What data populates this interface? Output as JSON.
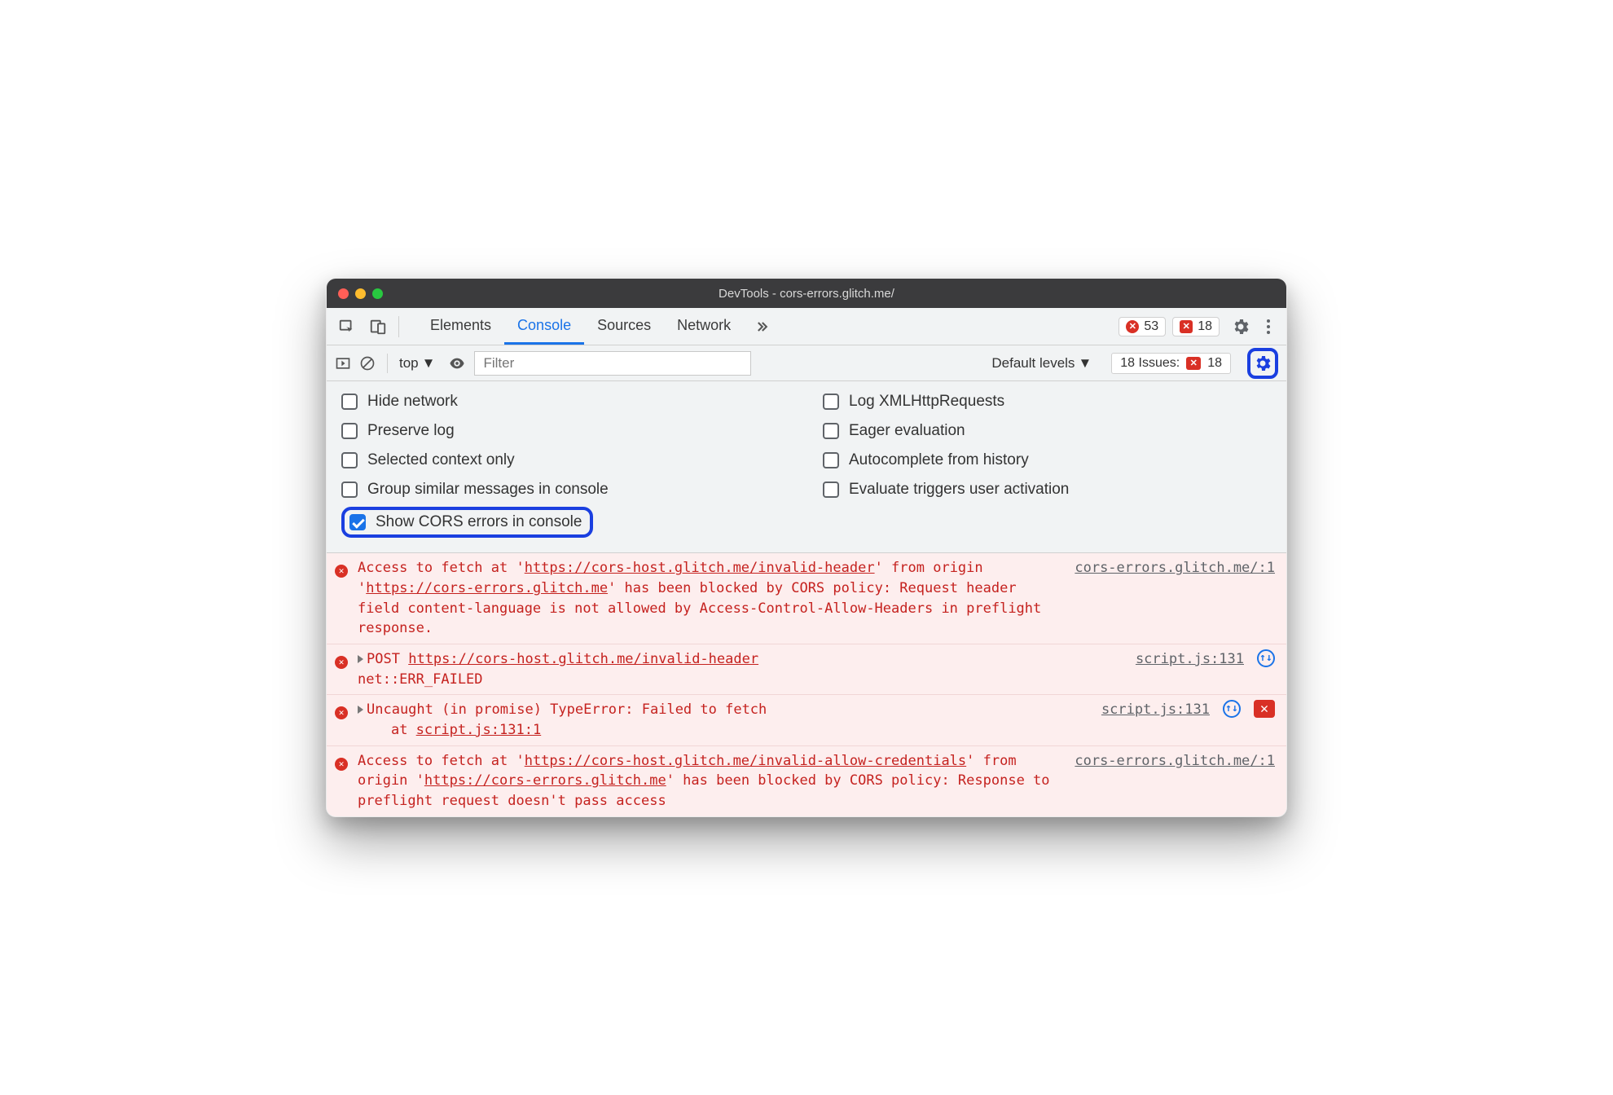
{
  "window": {
    "title": "DevTools - cors-errors.glitch.me/"
  },
  "tabs": {
    "items": [
      "Elements",
      "Console",
      "Sources",
      "Network"
    ],
    "active_index": 1
  },
  "tabbar_badges": {
    "errors": "53",
    "issues": "18"
  },
  "toolbar": {
    "context": "top",
    "filter_placeholder": "Filter",
    "levels_label": "Default levels",
    "issues_label": "18 Issues:",
    "issues_count": "18"
  },
  "settings": {
    "left": [
      {
        "label": "Hide network",
        "checked": false
      },
      {
        "label": "Preserve log",
        "checked": false
      },
      {
        "label": "Selected context only",
        "checked": false
      },
      {
        "label": "Group similar messages in console",
        "checked": false
      },
      {
        "label": "Show CORS errors in console",
        "checked": true,
        "highlight": true
      }
    ],
    "right": [
      {
        "label": "Log XMLHttpRequests",
        "checked": false
      },
      {
        "label": "Eager evaluation",
        "checked": false
      },
      {
        "label": "Autocomplete from history",
        "checked": false
      },
      {
        "label": "Evaluate triggers user activation",
        "checked": false
      }
    ]
  },
  "log_entries": [
    {
      "type": "cors",
      "pre": "Access to fetch at '",
      "url1": "https://cors-host.glitch.me/invalid-header",
      "mid": "' from origin '",
      "url2": "https://cors-errors.glitch.me",
      "post": "' has been blocked by CORS policy: Request header field content-language is not allowed by Access-Control-Allow-Headers in preflight response.",
      "source": "cors-errors.glitch.me/:1"
    },
    {
      "type": "net",
      "method": "POST",
      "url": "https://cors-host.glitch.me/invalid-header",
      "status": "net::ERR_FAILED",
      "source": "script.js:131"
    },
    {
      "type": "exception",
      "line1": "Uncaught (in promise) TypeError: Failed to fetch",
      "line2_prefix": "    at ",
      "line2_link": "script.js:131:1",
      "source": "script.js:131"
    },
    {
      "type": "cors",
      "pre": "Access to fetch at '",
      "url1": "https://cors-host.glitch.me/invalid-allow-credentials",
      "mid": "' from origin '",
      "url2": "https://cors-errors.glitch.me",
      "post": "' has been blocked by CORS policy: Response to preflight request doesn't pass access",
      "source": "cors-errors.glitch.me/:1"
    }
  ]
}
